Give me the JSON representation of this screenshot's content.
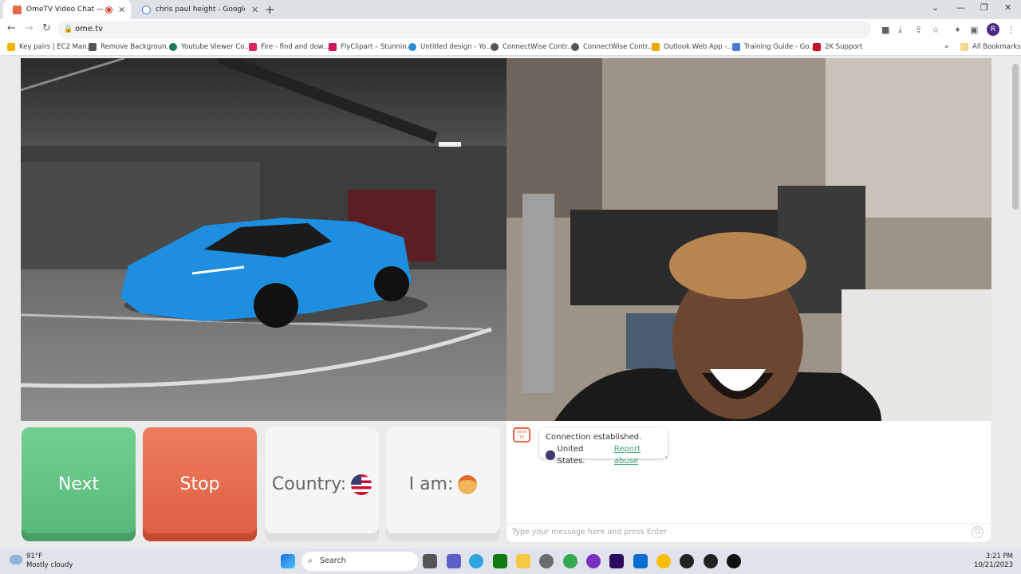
{
  "browser": {
    "tabs": [
      {
        "title": "OmeTV Video Chat — Top",
        "active": true
      },
      {
        "title": "chris paul height - Google Search",
        "active": false
      }
    ],
    "url": "ome.tv",
    "avatar_letter": "R",
    "bookmarks": [
      "Key pairs | EC2 Man...",
      "Remove Backgroun...",
      "Youtube Viewer Co...",
      "Fire - find and dow...",
      "FlyClipart – Stunnin...",
      "Untitled design - Yo...",
      "ConnectWise Contr...",
      "ConnectWise Contr...",
      "Outlook Web App -...",
      "Training Guide - Go...",
      "2K Support"
    ],
    "all_bookmarks": "All Bookmarks"
  },
  "controls": {
    "next": "Next",
    "stop": "Stop",
    "country": "Country:",
    "i_am": "I am:"
  },
  "chat": {
    "status": "Connection established.",
    "country": "United States.",
    "report": "Report abuse",
    "placeholder": "Type your message here and press Enter",
    "logo": "Ome TV"
  },
  "taskbar": {
    "weather_temp": "91°F",
    "weather_desc": "Mostly cloudy",
    "search": "Search",
    "time": "3:21 PM",
    "date": "10/21/2023"
  }
}
